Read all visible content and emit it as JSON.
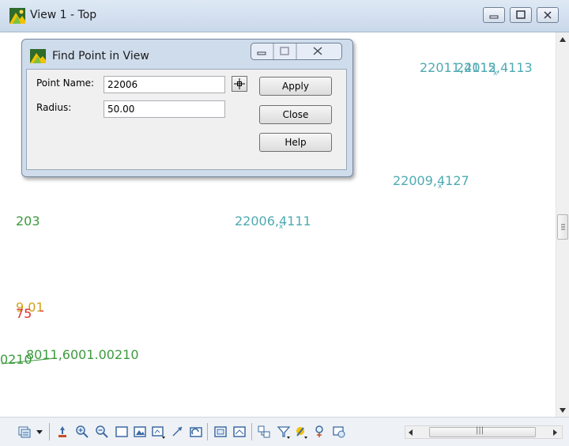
{
  "window": {
    "title": "View 1 - Top"
  },
  "viewport_labels": [
    {
      "text": "22011,4115",
      "color": "#4faab1"
    },
    {
      "text": "22012,4113",
      "color": "#4faab1"
    },
    {
      "text": "22009,4127",
      "color": "#4faab1"
    },
    {
      "text": "203",
      "color": "#3c9a3c"
    },
    {
      "text": "22006,4111",
      "color": "#4faab1"
    },
    {
      "text": "9.01",
      "color": "#d4a017"
    },
    {
      "text": "75",
      "color": "#e03030"
    },
    {
      "text": "-",
      "color": "#e03030"
    },
    {
      "text": "0210",
      "color": "#3c9a3c"
    },
    {
      "text": "8011,6001.00210",
      "color": "#3c9a3c"
    }
  ],
  "dialog": {
    "title": "Find Point in View",
    "point_name_label": "Point Name:",
    "point_name_value": "22006",
    "radius_label": "Radius:",
    "radius_value": "50.00",
    "apply_label": "Apply",
    "close_label": "Close",
    "help_label": "Help"
  },
  "toolbar": {
    "icons": [
      "view-list-icon",
      "dropdown-arrow-icon",
      "pan-icon",
      "zoom-in-icon",
      "zoom-out-icon",
      "zoom-window-icon",
      "zoom-extents-icon",
      "zoom-previous-icon",
      "rotate-icon",
      "redraw-icon",
      "view-window-icon",
      "view-fit-icon",
      "layer-icon",
      "filter-icon",
      "display-icon",
      "search-point-icon",
      "view-settings-icon"
    ],
    "grip": "|||"
  },
  "colors": {
    "point_cyan": "#4faab1",
    "point_green": "#3c9a3c",
    "point_red": "#e03030",
    "point_orange": "#d4a017"
  }
}
